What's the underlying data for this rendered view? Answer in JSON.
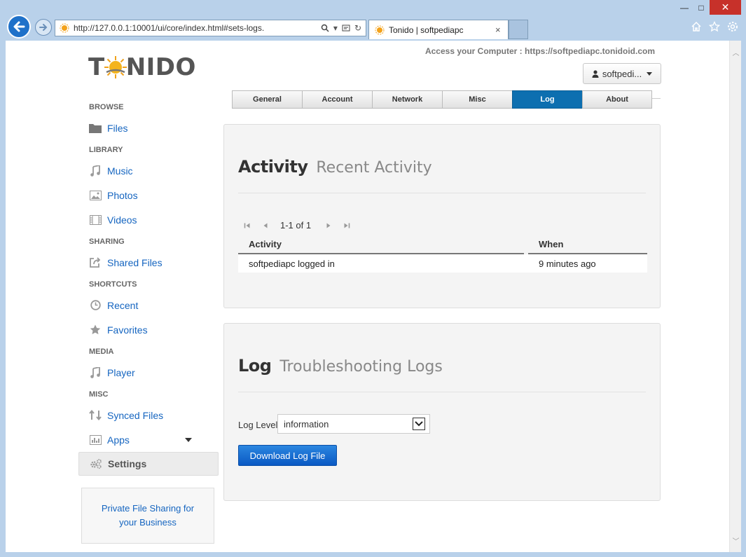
{
  "browser": {
    "address_url": "http://127.0.0.1:10001/ui/core/index.html#sets-logs.",
    "tab_title": "Tonido | softpediapc",
    "tab_close": "×",
    "window_controls": {
      "minimize": "—",
      "maximize": "□",
      "close": "✕"
    }
  },
  "header": {
    "logo_text_left": "T",
    "logo_text_right": "NIDO",
    "access_text": "Access your Computer : https://softpediapc.tonidoid.com",
    "user_label": "softpedi..."
  },
  "sidebar": {
    "browse_head": "BROWSE",
    "files": "Files",
    "library_head": "LIBRARY",
    "music": "Music",
    "photos": "Photos",
    "videos": "Videos",
    "sharing_head": "SHARING",
    "shared_files": "Shared Files",
    "shortcuts_head": "SHORTCUTS",
    "recent": "Recent",
    "favorites": "Favorites",
    "media_head": "MEDIA",
    "player": "Player",
    "misc_head": "MISC",
    "synced_files": "Synced Files",
    "apps": "Apps",
    "settings": "Settings",
    "promo_text": "Private File Sharing for your Business"
  },
  "tabs": [
    "General",
    "Account",
    "Network",
    "Misc",
    "Log",
    "About"
  ],
  "selected_tab": "Log",
  "activity": {
    "title": "Activity",
    "subtitle": "Recent Activity",
    "pager_text": "1-1 of 1",
    "columns": [
      "Activity",
      "When"
    ],
    "rows": [
      {
        "activity": "softpediapc logged in",
        "when": "9 minutes ago"
      }
    ]
  },
  "log": {
    "title": "Log",
    "subtitle": "Troubleshooting Logs",
    "level_label": "Log Level",
    "level_value": "information",
    "download_button": "Download Log File"
  },
  "colors": {
    "accent": "#0d6fb0",
    "link": "#1565c0",
    "button": "#0a59c4"
  }
}
